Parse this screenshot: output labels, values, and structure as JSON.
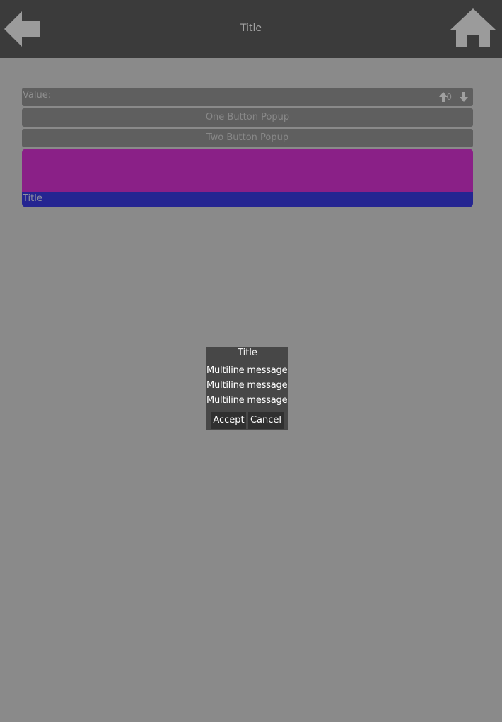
{
  "header": {
    "title": "Title",
    "back_icon": "arrow-left-icon",
    "home_icon": "home-icon"
  },
  "value_row": {
    "label": "Value:",
    "value": "0",
    "up_icon": "arrow-up-icon",
    "down_icon": "arrow-down-icon"
  },
  "buttons": {
    "one_button_popup": "One Button Popup",
    "two_button_popup": "Two Button Popup"
  },
  "color_panel": {
    "color": "#8a2087",
    "caption_color": "#252591",
    "caption": "Title"
  },
  "popup": {
    "title": "Title",
    "message_lines": [
      "Multiline message",
      "Multiline message",
      "Multiline message"
    ],
    "accept_label": "Accept",
    "cancel_label": "Cancel"
  }
}
